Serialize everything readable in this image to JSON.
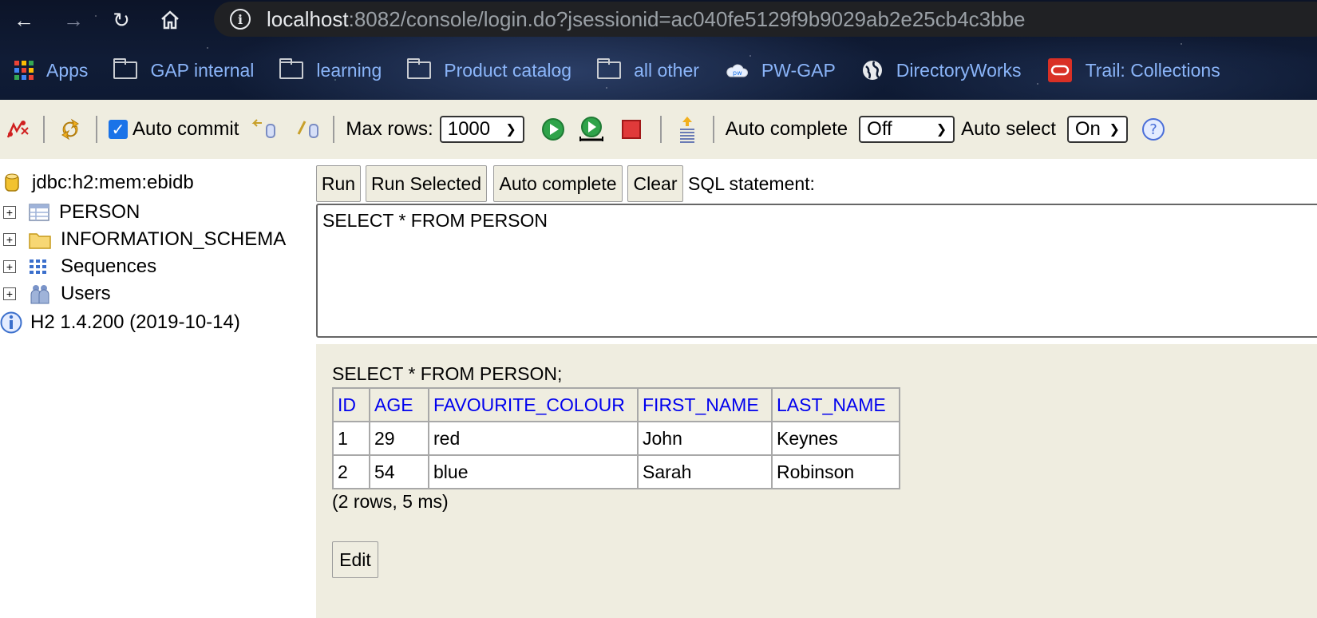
{
  "browser": {
    "url_host": "localhost",
    "url_rest": ":8082/console/login.do?jsessionid=ac040fe5129f9b9029ab2e25cb4c3bbe",
    "bookmarks": [
      {
        "label": "Apps",
        "icon": "apps-grid-icon"
      },
      {
        "label": "GAP internal",
        "icon": "folder-icon"
      },
      {
        "label": "learning",
        "icon": "folder-icon"
      },
      {
        "label": "Product catalog",
        "icon": "folder-icon"
      },
      {
        "label": "all other",
        "icon": "folder-icon"
      },
      {
        "label": "PW-GAP",
        "icon": "cloud-icon"
      },
      {
        "label": "DirectoryWorks",
        "icon": "globe-icon"
      },
      {
        "label": "Trail: Collections",
        "icon": "oracle-icon"
      }
    ]
  },
  "toolbar": {
    "auto_commit_label": "Auto commit",
    "auto_commit_checked": true,
    "max_rows_label": "Max rows:",
    "max_rows_value": "1000",
    "auto_complete_label": "Auto complete",
    "auto_complete_value": "Off",
    "auto_select_label": "Auto select",
    "auto_select_value": "On",
    "help_glyph": "?"
  },
  "tree": {
    "connection": "jdbc:h2:mem:ebidb",
    "items": [
      {
        "label": "PERSON",
        "icon": "table-icon"
      },
      {
        "label": "INFORMATION_SCHEMA",
        "icon": "folder-icon"
      },
      {
        "label": "Sequences",
        "icon": "sequences-icon"
      },
      {
        "label": "Users",
        "icon": "users-icon"
      }
    ],
    "version": "H2 1.4.200 (2019-10-14)"
  },
  "query": {
    "buttons": {
      "run": "Run",
      "run_selected": "Run Selected",
      "auto_complete": "Auto complete",
      "clear": "Clear"
    },
    "sql_label": "SQL statement:",
    "sql_text": "SELECT * FROM PERSON"
  },
  "result": {
    "query_echo": "SELECT * FROM PERSON;",
    "columns": [
      "ID",
      "AGE",
      "FAVOURITE_COLOUR",
      "FIRST_NAME",
      "LAST_NAME"
    ],
    "rows": [
      [
        "1",
        "29",
        "red",
        "John",
        "Keynes"
      ],
      [
        "2",
        "54",
        "blue",
        "Sarah",
        "Robinson"
      ]
    ],
    "summary": "(2 rows, 5 ms)",
    "edit_label": "Edit"
  },
  "colors": {
    "toolbar_bg": "#efede0",
    "link_blue": "#0000ee",
    "bookmark_text": "#8ab4f8"
  }
}
